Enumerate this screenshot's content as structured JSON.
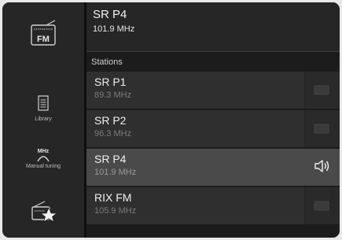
{
  "sidebar": {
    "items": [
      {
        "id": "fm",
        "icon": "radio-fm-icon",
        "badge": "FM",
        "label": ""
      },
      {
        "id": "library",
        "icon": "library-icon",
        "label": "Library"
      },
      {
        "id": "manual",
        "icon": "dial-icon",
        "badge": "MHz",
        "label": "Manual tuning"
      },
      {
        "id": "favorites",
        "icon": "favorite-radio-icon",
        "label": ""
      }
    ]
  },
  "now_playing": {
    "name": "SR P4",
    "frequency": "101.9 MHz"
  },
  "stations_title": "Stations",
  "stations": [
    {
      "name": "SR P1",
      "frequency": "89.3 MHz",
      "active": false
    },
    {
      "name": "SR P2",
      "frequency": "96.3 MHz",
      "active": false
    },
    {
      "name": "SR P4",
      "frequency": "101.9 MHz",
      "active": true
    },
    {
      "name": "RIX FM",
      "frequency": "105.9 MHz",
      "active": false
    }
  ],
  "image_code": "G063314",
  "colors": {
    "background": "#1c1c1c",
    "sidebar": "#262626",
    "row": "#2f2f2f",
    "active_row": "#4a4a4a"
  }
}
